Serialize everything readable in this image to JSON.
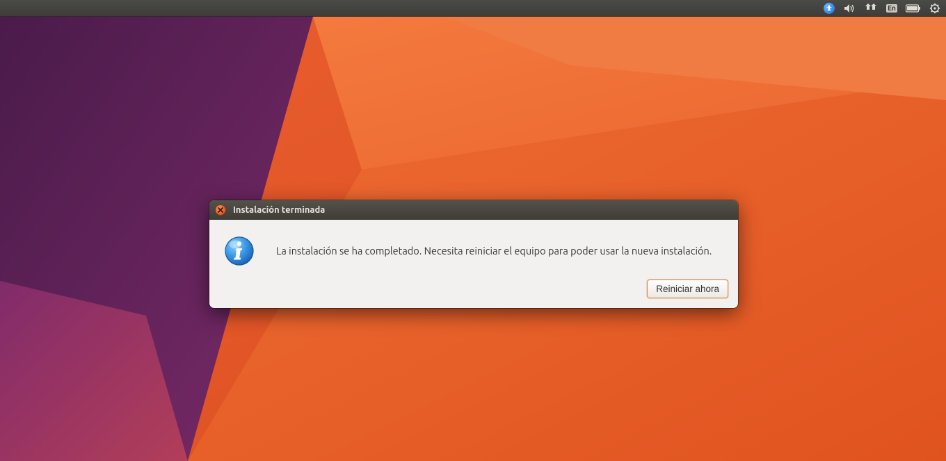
{
  "topbar": {
    "keyboard_layout": "En"
  },
  "dialog": {
    "title": "Instalación terminada",
    "message": "La instalación se ha completado. Necesita reiniciar el equipo para poder usar la nueva instalación.",
    "restart_label": "Reiniciar ahora"
  }
}
